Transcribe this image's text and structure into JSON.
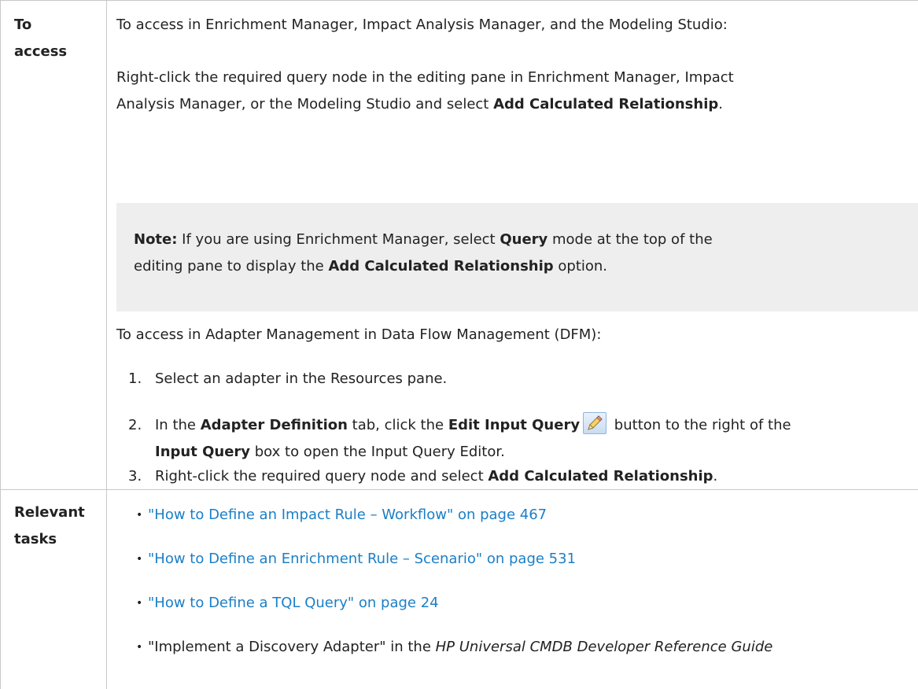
{
  "rows": [
    {
      "label_line1": "To",
      "label_line2": "access",
      "intro": "To access in Enrichment Manager, Impact Analysis Manager, and the Modeling Studio:",
      "rc_line1": "Right-click the required query node in the editing pane in Enrichment Manager, Impact",
      "rc_line2_pre": "Analysis Manager, or the Modeling Studio and select ",
      "rc_line2_bold": "Add Calculated Relationship",
      "rc_line2_post": ".",
      "note": {
        "label": "Note:",
        "line1_pre": " If you are using Enrichment Manager, select ",
        "line1_bold": "Query",
        "line1_post": " mode at the top of the",
        "line2_pre": "editing pane to display the ",
        "line2_bold": "Add Calculated Relationship",
        "line2_post": " option."
      },
      "dfm_intro": "To access in Adapter Management in Data Flow Management (DFM):",
      "steps": [
        {
          "num": "1.",
          "text": "Select an adapter in the Resources pane."
        },
        {
          "num": "2.",
          "pre": "In the ",
          "bold1": "Adapter Definition",
          "mid1": " tab, click the ",
          "bold2": "Edit Input Query",
          "post": " button to the right of the",
          "line2_bold": "Input Query",
          "line2_post": " box to open the Input Query Editor.",
          "icon": "pencil-edit-icon"
        },
        {
          "num": "3.",
          "pre": "Right-click the required query node and select ",
          "bold": "Add Calculated Relationship",
          "post": "."
        }
      ]
    },
    {
      "label_line1": "Relevant",
      "label_line2": "tasks",
      "bullet": "•",
      "items": [
        {
          "text": "\"How to Define an Impact Rule – Workflow\" on page 467"
        },
        {
          "text": "\"How to Define an Enrichment Rule – Scenario\" on page 531"
        },
        {
          "text": "\"How to Define a TQL Query\" on page 24"
        },
        {
          "pre": "\"Implement a Discovery Adapter\" in the ",
          "italic": "HP Universal CMDB Developer Reference Guide"
        }
      ]
    }
  ],
  "colors": {
    "link": "#1b7fc6",
    "border": "#c8c8c8",
    "note_bg": "#eeeeee"
  }
}
